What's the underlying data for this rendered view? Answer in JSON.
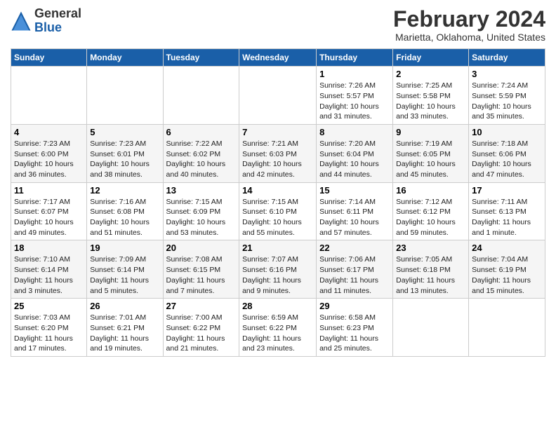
{
  "header": {
    "logo_line1": "General",
    "logo_line2": "Blue",
    "month": "February 2024",
    "location": "Marietta, Oklahoma, United States"
  },
  "weekdays": [
    "Sunday",
    "Monday",
    "Tuesday",
    "Wednesday",
    "Thursday",
    "Friday",
    "Saturday"
  ],
  "weeks": [
    [
      {
        "day": "",
        "info": ""
      },
      {
        "day": "",
        "info": ""
      },
      {
        "day": "",
        "info": ""
      },
      {
        "day": "",
        "info": ""
      },
      {
        "day": "1",
        "info": "Sunrise: 7:26 AM\nSunset: 5:57 PM\nDaylight: 10 hours\nand 31 minutes."
      },
      {
        "day": "2",
        "info": "Sunrise: 7:25 AM\nSunset: 5:58 PM\nDaylight: 10 hours\nand 33 minutes."
      },
      {
        "day": "3",
        "info": "Sunrise: 7:24 AM\nSunset: 5:59 PM\nDaylight: 10 hours\nand 35 minutes."
      }
    ],
    [
      {
        "day": "4",
        "info": "Sunrise: 7:23 AM\nSunset: 6:00 PM\nDaylight: 10 hours\nand 36 minutes."
      },
      {
        "day": "5",
        "info": "Sunrise: 7:23 AM\nSunset: 6:01 PM\nDaylight: 10 hours\nand 38 minutes."
      },
      {
        "day": "6",
        "info": "Sunrise: 7:22 AM\nSunset: 6:02 PM\nDaylight: 10 hours\nand 40 minutes."
      },
      {
        "day": "7",
        "info": "Sunrise: 7:21 AM\nSunset: 6:03 PM\nDaylight: 10 hours\nand 42 minutes."
      },
      {
        "day": "8",
        "info": "Sunrise: 7:20 AM\nSunset: 6:04 PM\nDaylight: 10 hours\nand 44 minutes."
      },
      {
        "day": "9",
        "info": "Sunrise: 7:19 AM\nSunset: 6:05 PM\nDaylight: 10 hours\nand 45 minutes."
      },
      {
        "day": "10",
        "info": "Sunrise: 7:18 AM\nSunset: 6:06 PM\nDaylight: 10 hours\nand 47 minutes."
      }
    ],
    [
      {
        "day": "11",
        "info": "Sunrise: 7:17 AM\nSunset: 6:07 PM\nDaylight: 10 hours\nand 49 minutes."
      },
      {
        "day": "12",
        "info": "Sunrise: 7:16 AM\nSunset: 6:08 PM\nDaylight: 10 hours\nand 51 minutes."
      },
      {
        "day": "13",
        "info": "Sunrise: 7:15 AM\nSunset: 6:09 PM\nDaylight: 10 hours\nand 53 minutes."
      },
      {
        "day": "14",
        "info": "Sunrise: 7:15 AM\nSunset: 6:10 PM\nDaylight: 10 hours\nand 55 minutes."
      },
      {
        "day": "15",
        "info": "Sunrise: 7:14 AM\nSunset: 6:11 PM\nDaylight: 10 hours\nand 57 minutes."
      },
      {
        "day": "16",
        "info": "Sunrise: 7:12 AM\nSunset: 6:12 PM\nDaylight: 10 hours\nand 59 minutes."
      },
      {
        "day": "17",
        "info": "Sunrise: 7:11 AM\nSunset: 6:13 PM\nDaylight: 11 hours\nand 1 minute."
      }
    ],
    [
      {
        "day": "18",
        "info": "Sunrise: 7:10 AM\nSunset: 6:14 PM\nDaylight: 11 hours\nand 3 minutes."
      },
      {
        "day": "19",
        "info": "Sunrise: 7:09 AM\nSunset: 6:14 PM\nDaylight: 11 hours\nand 5 minutes."
      },
      {
        "day": "20",
        "info": "Sunrise: 7:08 AM\nSunset: 6:15 PM\nDaylight: 11 hours\nand 7 minutes."
      },
      {
        "day": "21",
        "info": "Sunrise: 7:07 AM\nSunset: 6:16 PM\nDaylight: 11 hours\nand 9 minutes."
      },
      {
        "day": "22",
        "info": "Sunrise: 7:06 AM\nSunset: 6:17 PM\nDaylight: 11 hours\nand 11 minutes."
      },
      {
        "day": "23",
        "info": "Sunrise: 7:05 AM\nSunset: 6:18 PM\nDaylight: 11 hours\nand 13 minutes."
      },
      {
        "day": "24",
        "info": "Sunrise: 7:04 AM\nSunset: 6:19 PM\nDaylight: 11 hours\nand 15 minutes."
      }
    ],
    [
      {
        "day": "25",
        "info": "Sunrise: 7:03 AM\nSunset: 6:20 PM\nDaylight: 11 hours\nand 17 minutes."
      },
      {
        "day": "26",
        "info": "Sunrise: 7:01 AM\nSunset: 6:21 PM\nDaylight: 11 hours\nand 19 minutes."
      },
      {
        "day": "27",
        "info": "Sunrise: 7:00 AM\nSunset: 6:22 PM\nDaylight: 11 hours\nand 21 minutes."
      },
      {
        "day": "28",
        "info": "Sunrise: 6:59 AM\nSunset: 6:22 PM\nDaylight: 11 hours\nand 23 minutes."
      },
      {
        "day": "29",
        "info": "Sunrise: 6:58 AM\nSunset: 6:23 PM\nDaylight: 11 hours\nand 25 minutes."
      },
      {
        "day": "",
        "info": ""
      },
      {
        "day": "",
        "info": ""
      }
    ]
  ]
}
